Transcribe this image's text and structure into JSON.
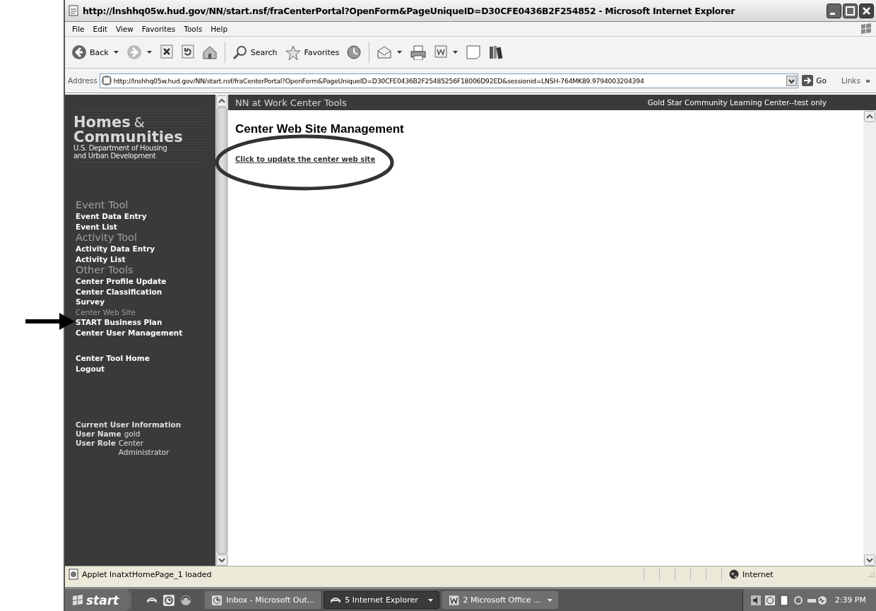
{
  "window": {
    "title": "http://lnshhq05w.hud.gov/NN/start.nsf/fraCenterPortal?OpenForm&PageUniqueID=D30CFE0436B2F254852 - Microsoft Internet Explorer"
  },
  "menu": [
    "File",
    "Edit",
    "View",
    "Favorites",
    "Tools",
    "Help"
  ],
  "toolbar": [
    {
      "kind": "back",
      "label": "Back",
      "dropdown": true
    },
    {
      "kind": "forward",
      "dropdown": true
    },
    {
      "kind": "stop"
    },
    {
      "kind": "refresh"
    },
    {
      "kind": "home"
    },
    {
      "kind": "search",
      "label": "Search"
    },
    {
      "kind": "favorites",
      "label": "Favorites"
    },
    {
      "kind": "history"
    },
    {
      "kind": "mail",
      "dropdown": true
    },
    {
      "kind": "print"
    },
    {
      "kind": "document",
      "dropdown": true
    },
    {
      "kind": "note"
    },
    {
      "kind": "research"
    }
  ],
  "address": {
    "label": "Address",
    "value": "http://lnshhq05w.hud.gov/NN/start.nsf/fraCenterPortal?OpenForm&PageUniqueID=D30CFE0436B2F25485256F18006D92ED&sessionid=LNSH-764MK89.9794003204394",
    "go": "Go",
    "links": "Links",
    "chevron": "»"
  },
  "sidebar": {
    "logo": {
      "title": "Homes",
      "amp": "&",
      "subtitle": "Communities",
      "line_1": "U.S. Department of Housing",
      "line_2": "and Urban Development"
    },
    "sections": [
      {
        "heading": "Event Tool",
        "items": [
          {
            "label": "Event Data Entry",
            "selected": false
          },
          {
            "label": "Event List",
            "selected": false
          }
        ]
      },
      {
        "heading": "Activity Tool",
        "items": [
          {
            "label": "Activity Data Entry",
            "selected": false
          },
          {
            "label": "Activity List",
            "selected": false
          }
        ]
      },
      {
        "heading": "Other Tools",
        "items": [
          {
            "label": "Center Profile Update",
            "selected": false
          },
          {
            "label": "Center Classification",
            "selected": false
          },
          {
            "label": "Survey",
            "selected": false
          },
          {
            "label": "Center Web Site",
            "selected": true
          },
          {
            "label": "START Business Plan",
            "selected": false
          },
          {
            "label": "Center User Management",
            "selected": false
          }
        ]
      }
    ],
    "extra_links": [
      "Center Tool Home",
      "Logout"
    ],
    "user_info": {
      "heading": "Current User Information",
      "fields": [
        {
          "label": "User Name",
          "value": "gold"
        },
        {
          "label": "User Role",
          "value": "Center Administrator"
        }
      ]
    }
  },
  "header": {
    "title": "NN at Work Center Tools",
    "center_name": "Gold Star Community Learning Center--test only"
  },
  "main": {
    "heading": "Center Web Site Management",
    "link": "Click to update the center web site"
  },
  "status_bar": {
    "message": "Applet lnatxtHomePage_1 loaded",
    "zone": "Internet"
  },
  "taskbar": {
    "start": "start",
    "tasks": [
      {
        "label": "Inbox - Microsoft Out...",
        "kind": "mail",
        "selected": false,
        "group": false
      },
      {
        "label": "5 Internet Explorer",
        "kind": "browser",
        "selected": true,
        "group": true
      },
      {
        "label": "2 Microsoft Office ...",
        "kind": "office",
        "selected": false,
        "group": true
      }
    ],
    "clock": "2:39 PM"
  }
}
